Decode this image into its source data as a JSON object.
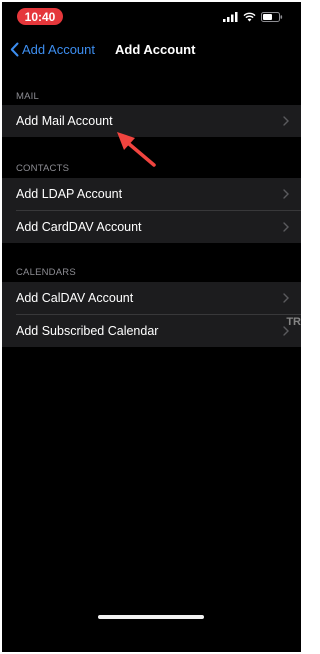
{
  "status_bar": {
    "time": "10:40",
    "icons": [
      "signal-icon",
      "wifi-icon",
      "battery-icon"
    ]
  },
  "nav": {
    "back_label": "Add Account",
    "title": "Add Account"
  },
  "sections": [
    {
      "header": "MAIL",
      "items": [
        {
          "label": "Add Mail Account"
        }
      ]
    },
    {
      "header": "CONTACTS",
      "items": [
        {
          "label": "Add LDAP Account"
        },
        {
          "label": "Add CardDAV Account"
        }
      ]
    },
    {
      "header": "CALENDARS",
      "items": [
        {
          "label": "Add CalDAV Account"
        },
        {
          "label": "Add Subscribed Calendar"
        }
      ]
    }
  ],
  "watermark": "TR",
  "colors": {
    "accent": "#3d8ef0",
    "time_pill": "#e5373b",
    "annotation_arrow": "#f0443f",
    "cell_background": "#1c1c1e",
    "background": "#000000"
  }
}
